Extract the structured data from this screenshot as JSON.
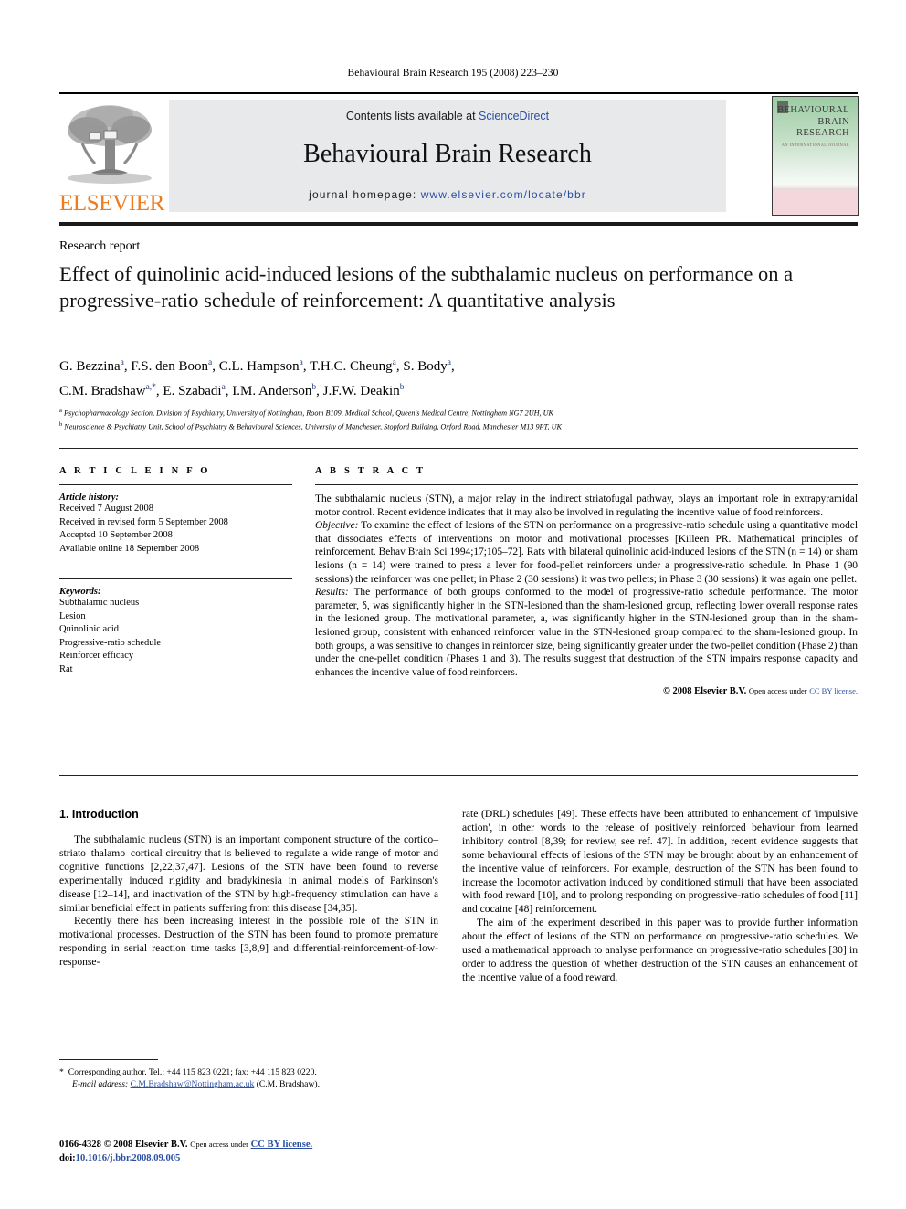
{
  "running_head": "Behavioural Brain Research 195 (2008) 223–230",
  "masthead": {
    "contents_prefix": "Contents lists available at ",
    "sciencedirect": "ScienceDirect",
    "journal_title": "Behavioural Brain Research",
    "homepage_label": "journal homepage:",
    "homepage_url": "www.elsevier.com/locate/bbr",
    "publisher_wordmark": "ELSEVIER",
    "cover": {
      "line1": "BEHAVIOURAL",
      "line2": "BRAIN",
      "line3": "RESEARCH",
      "subtitle": "AN INTERNATIONAL JOURNAL"
    }
  },
  "article": {
    "kind": "Research report",
    "title": "Effect of quinolinic acid-induced lesions of the subthalamic nucleus on performance on a progressive-ratio schedule of reinforcement: A quantitative analysis",
    "authors_line1": "G. Bezzina a, F.S. den Boon a, C.L. Hampson a, T.H.C. Cheung a, S. Body a,",
    "authors_line2": "C.M. Bradshaw a,*, E. Szabadi a, I.M. Anderson b, J.F.W. Deakin b",
    "affiliation_a": "Psychopharmacology Section, Division of Psychiatry, University of Nottingham, Room B109, Medical School, Queen's Medical Centre, Nottingham NG7 2UH, UK",
    "affiliation_b": "Neuroscience & Psychiatry Unit, School of Psychiatry & Behavioural Sciences, University of Manchester, Stopford Building, Oxford Road, Manchester M13 9PT, UK"
  },
  "info": {
    "label": "A R T I C L E    I N F O",
    "history_head": "Article history:",
    "history": [
      "Received 7 August 2008",
      "Received in revised form 5 September 2008",
      "Accepted 10 September 2008",
      "Available online 18 September 2008"
    ],
    "keywords_head": "Keywords:",
    "keywords": [
      "Subthalamic nucleus",
      "Lesion",
      "Quinolinic acid",
      "Progressive-ratio schedule",
      "Reinforcer efficacy",
      "Rat"
    ]
  },
  "abstract": {
    "label": "A B S T R A C T",
    "para1": "The subthalamic nucleus (STN), a major relay in the indirect striatofugal pathway, plays an important role in extrapyramidal motor control. Recent evidence indicates that it may also be involved in regulating the incentive value of food reinforcers.",
    "objective_label": "Objective:",
    "objective": " To examine the effect of lesions of the STN on performance on a progressive-ratio schedule using a quantitative model that dissociates effects of interventions on motor and motivational processes [Killeen PR. Mathematical principles of reinforcement. Behav Brain Sci 1994;17;105–72]. Rats with bilateral quinolinic acid-induced lesions of the STN (n = 14) or sham lesions (n = 14) were trained to press a lever for food-pellet reinforcers under a progressive-ratio schedule. In Phase 1 (90 sessions) the reinforcer was one pellet; in Phase 2 (30 sessions) it was two pellets; in Phase 3 (30 sessions) it was again one pellet.",
    "results_label": "Results:",
    "results": " The performance of both groups conformed to the model of progressive-ratio schedule performance. The motor parameter, δ, was significantly higher in the STN-lesioned than the sham-lesioned group, reflecting lower overall response rates in the lesioned group. The motivational parameter, a, was significantly higher in the STN-lesioned group than in the sham-lesioned group, consistent with enhanced reinforcer value in the STN-lesioned group compared to the sham-lesioned group. In both groups, a was sensitive to changes in reinforcer size, being significantly greater under the two-pellet condition (Phase 2) than under the one-pellet condition (Phases 1 and 3). The results suggest that destruction of the STN impairs response capacity and enhances the incentive value of food reinforcers.",
    "copyright": "© 2008 Elsevier B.V.",
    "open_access": "Open access under",
    "license": "CC BY license."
  },
  "body": {
    "intro_heading": "1.  Introduction",
    "left_p1": "The subthalamic nucleus (STN) is an important component structure of the cortico–striato–thalamo–cortical circuitry that is believed to regulate a wide range of motor and cognitive functions [2,22,37,47]. Lesions of the STN have been found to reverse experimentally induced rigidity and bradykinesia in animal models of Parkinson's disease [12–14], and inactivation of the STN by high-frequency stimulation can have a similar beneficial effect in patients suffering from this disease [34,35].",
    "left_p2": "Recently there has been increasing interest in the possible role of the STN in motivational processes. Destruction of the STN has been found to promote premature responding in serial reaction time tasks [3,8,9] and differential-reinforcement-of-low-response-",
    "right_p1": "rate (DRL) schedules [49]. These effects have been attributed to enhancement of 'impulsive action', in other words to the release of positively reinforced behaviour from learned inhibitory control [8,39; for review, see ref. 47]. In addition, recent evidence suggests that some behavioural effects of lesions of the STN may be brought about by an enhancement of the incentive value of reinforcers. For example, destruction of the STN has been found to increase the locomotor activation induced by conditioned stimuli that have been associated with food reward [10], and to prolong responding on progressive-ratio schedules of food [11] and cocaine [48] reinforcement.",
    "right_p2": "The aim of the experiment described in this paper was to provide further information about the effect of lesions of the STN on performance on progressive-ratio schedules. We used a mathematical approach to analyse performance on progressive-ratio schedules [30] in order to address the question of whether destruction of the STN causes an enhancement of the incentive value of a food reward."
  },
  "footnote": {
    "corresponding": "Corresponding author. Tel.: +44 115 823 0221; fax: +44 115 823 0220.",
    "email_label": "E-mail address:",
    "email": "C.M.Bradshaw@Nottingham.ac.uk",
    "email_attrib": "(C.M. Bradshaw)."
  },
  "footer": {
    "issn": "0166-4328",
    "copyright": "© 2008 Elsevier B.V.",
    "open_access": "Open access under",
    "license": "CC BY license.",
    "doi_label": "doi:",
    "doi": "10.1016/j.bbr.2008.09.005"
  },
  "colors": {
    "link": "#2A4FA2",
    "elsevier_orange": "#ED7B20",
    "band": "#E8E9EB"
  }
}
